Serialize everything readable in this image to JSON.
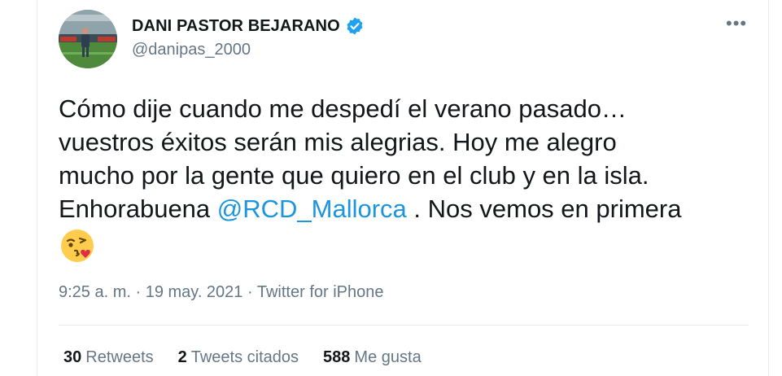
{
  "author": {
    "display_name": "DANI PASTOR BEJARANO",
    "handle": "@danipas_2000",
    "verified": true,
    "avatar_icon": "goalkeeper-photo"
  },
  "more_icon": "•••",
  "tweet": {
    "line1": "Cómo dije cuando me despedí el verano pasado…",
    "line2": "vuestros éxitos serán mis alegrias. Hoy me alegro",
    "line3": "mucho por la gente que quiero en el club y en la isla.",
    "line4_before": "Enhorabuena ",
    "mention": "@RCD_Mallorca",
    "line4_after": " . Nos vemos en primera",
    "emoji": "face-blowing-a-kiss"
  },
  "meta": {
    "time": "9:25 a. m.",
    "sep1": " · ",
    "date": "19 may. 2021",
    "sep2": " · ",
    "source": "Twitter for iPhone"
  },
  "stats": {
    "retweets_count": "30",
    "retweets_label": "Retweets",
    "quotes_count": "2",
    "quotes_label": "Tweets citados",
    "likes_count": "588",
    "likes_label": "Me gusta"
  },
  "colors": {
    "link": "#1b95e0",
    "verified": "#1da1f2",
    "secondary_text": "#657786",
    "primary_text": "#14171a"
  }
}
